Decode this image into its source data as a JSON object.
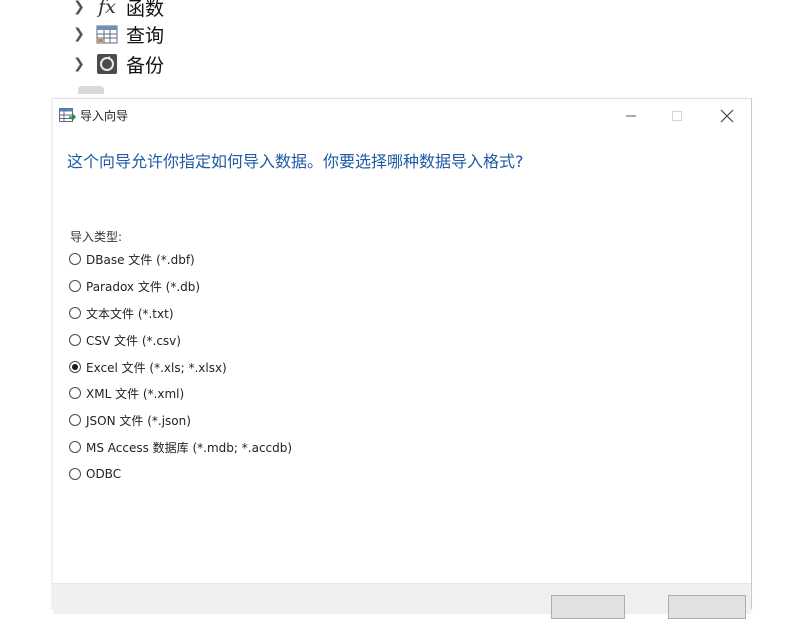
{
  "navigator": {
    "items": [
      {
        "label": "函数",
        "icon": "function-icon"
      },
      {
        "label": "查询",
        "icon": "query-table-icon"
      },
      {
        "label": "备份",
        "icon": "backup-icon"
      }
    ]
  },
  "dialog": {
    "title": "导入向导",
    "heading": "这个向导允许你指定如何导入数据。你要选择哪种数据导入格式?",
    "type_label": "导入类型:",
    "selected_index": 4,
    "options": [
      {
        "label": "DBase 文件 (*.dbf)"
      },
      {
        "label": "Paradox 文件 (*.db)"
      },
      {
        "label": "文本文件 (*.txt)"
      },
      {
        "label": "CSV 文件 (*.csv)"
      },
      {
        "label": "Excel 文件 (*.xls; *.xlsx)"
      },
      {
        "label": "XML 文件 (*.xml)"
      },
      {
        "label": "JSON 文件 (*.json)"
      },
      {
        "label": "MS Access 数据库 (*.mdb; *.accdb)"
      },
      {
        "label": "ODBC"
      }
    ],
    "footer_buttons": [
      "",
      "",
      ""
    ]
  }
}
